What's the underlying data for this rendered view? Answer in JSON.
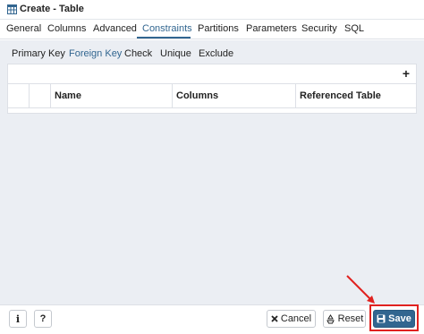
{
  "window": {
    "title": "Create - Table"
  },
  "tabs": [
    {
      "label": "General"
    },
    {
      "label": "Columns"
    },
    {
      "label": "Advanced"
    },
    {
      "label": "Constraints"
    },
    {
      "label": "Partitions"
    },
    {
      "label": "Parameters"
    },
    {
      "label": "Security"
    },
    {
      "label": "SQL"
    }
  ],
  "active_tab": "Constraints",
  "subtabs": [
    {
      "label": "Primary Key"
    },
    {
      "label": "Foreign Key"
    },
    {
      "label": "Check"
    },
    {
      "label": "Unique"
    },
    {
      "label": "Exclude"
    }
  ],
  "active_subtab": "Foreign Key",
  "grid": {
    "add_label": "+",
    "columns": [
      "Name",
      "Columns",
      "Referenced Table"
    ]
  },
  "footer": {
    "info_label": "i",
    "help_label": "?",
    "cancel_label": "Cancel",
    "reset_label": "Reset",
    "save_label": "Save"
  },
  "colors": {
    "accent": "#326690",
    "highlight": "#e0221f",
    "panel_bg": "#ebeef3"
  },
  "icons": [
    "table-icon",
    "close-icon",
    "recycle-icon",
    "save-icon"
  ]
}
